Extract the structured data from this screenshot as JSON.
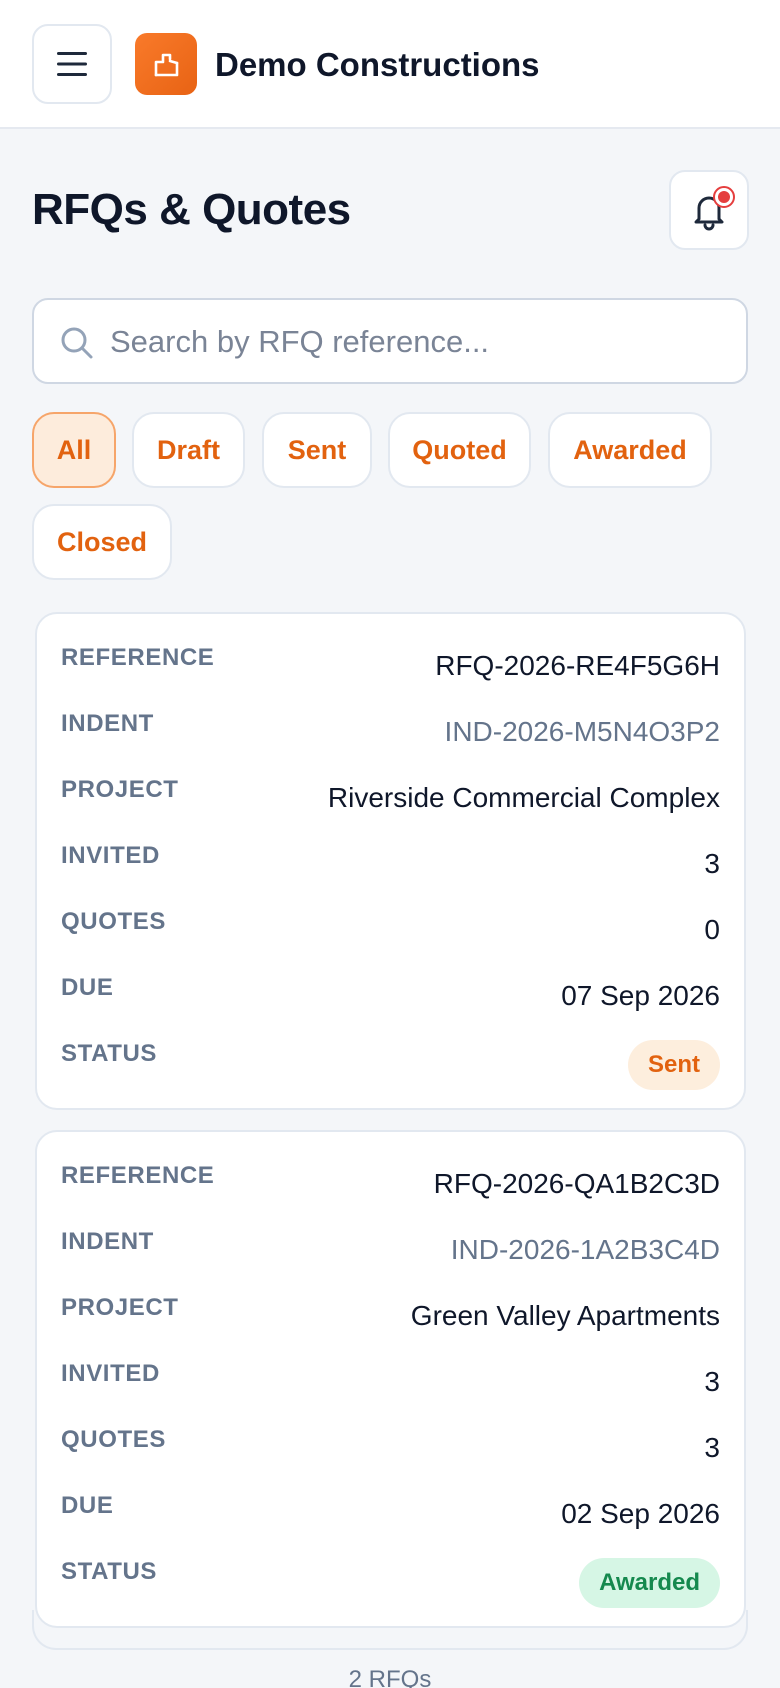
{
  "header": {
    "app_name": "Demo Constructions",
    "menu_icon": "hamburger-menu-icon",
    "logo_icon": "building-logo-icon",
    "brand_color": "#f06d1c"
  },
  "page": {
    "title": "RFQs & Quotes",
    "notification_icon": "bell-icon"
  },
  "search": {
    "placeholder": "Search by RFQ reference...",
    "value": ""
  },
  "filters": [
    {
      "label": "All",
      "active": true
    },
    {
      "label": "Draft",
      "active": false
    },
    {
      "label": "Sent",
      "active": false
    },
    {
      "label": "Quoted",
      "active": false
    },
    {
      "label": "Awarded",
      "active": false
    },
    {
      "label": "Closed",
      "active": false
    }
  ],
  "labels": {
    "reference": "REFERENCE",
    "indent": "INDENT",
    "project": "PROJECT",
    "invited": "INVITED",
    "quotes": "QUOTES",
    "due": "DUE",
    "status": "STATUS"
  },
  "rfqs": [
    {
      "reference": "RFQ-2026-RE4F5G6H",
      "indent": "IND-2026-M5N4O3P2",
      "project": "Riverside Commercial Complex",
      "invited": "3",
      "quotes": "0",
      "due": "07 Sep 2026",
      "status": "Sent"
    },
    {
      "reference": "RFQ-2026-QA1B2C3D",
      "indent": "IND-2026-1A2B3C4D",
      "project": "Green Valley Apartments",
      "invited": "3",
      "quotes": "3",
      "due": "02 Sep 2026",
      "status": "Awarded"
    }
  ],
  "footer": {
    "count": "2 RFQs"
  }
}
